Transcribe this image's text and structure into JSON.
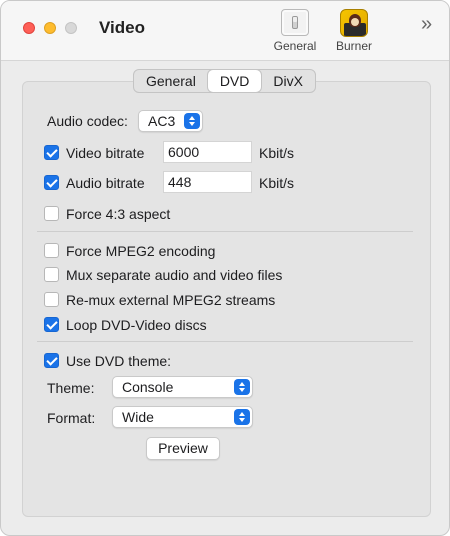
{
  "window": {
    "title": "Video"
  },
  "toolbar": {
    "general_label": "General",
    "burner_label": "Burner",
    "overflow_icon": "chevron-double-right-icon"
  },
  "tabs": [
    {
      "label": "General",
      "active": false
    },
    {
      "label": "DVD",
      "active": true
    },
    {
      "label": "DivX",
      "active": false
    }
  ],
  "dvd": {
    "audio_codec": {
      "label": "Audio codec:",
      "value": "AC3"
    },
    "video_bitrate": {
      "label": "Video bitrate",
      "checked": true,
      "value": "6000",
      "unit": "Kbit/s"
    },
    "audio_bitrate": {
      "label": "Audio bitrate",
      "checked": true,
      "value": "448",
      "unit": "Kbit/s"
    },
    "force_aspect": {
      "label": "Force 4:3 aspect",
      "checked": false
    },
    "force_mpeg2": {
      "label": "Force MPEG2 encoding",
      "checked": false
    },
    "mux_separate": {
      "label": "Mux separate audio and video files",
      "checked": false
    },
    "remux_external": {
      "label": "Re-mux external MPEG2 streams",
      "checked": false
    },
    "loop_dvd": {
      "label": "Loop DVD-Video discs",
      "checked": true
    },
    "use_theme": {
      "label": "Use DVD theme:",
      "checked": true
    },
    "theme": {
      "label": "Theme:",
      "value": "Console"
    },
    "format": {
      "label": "Format:",
      "value": "Wide"
    },
    "preview_label": "Preview"
  },
  "colors": {
    "accent": "#1a73e8",
    "close": "#fe5f57",
    "minimize": "#febc2e"
  }
}
